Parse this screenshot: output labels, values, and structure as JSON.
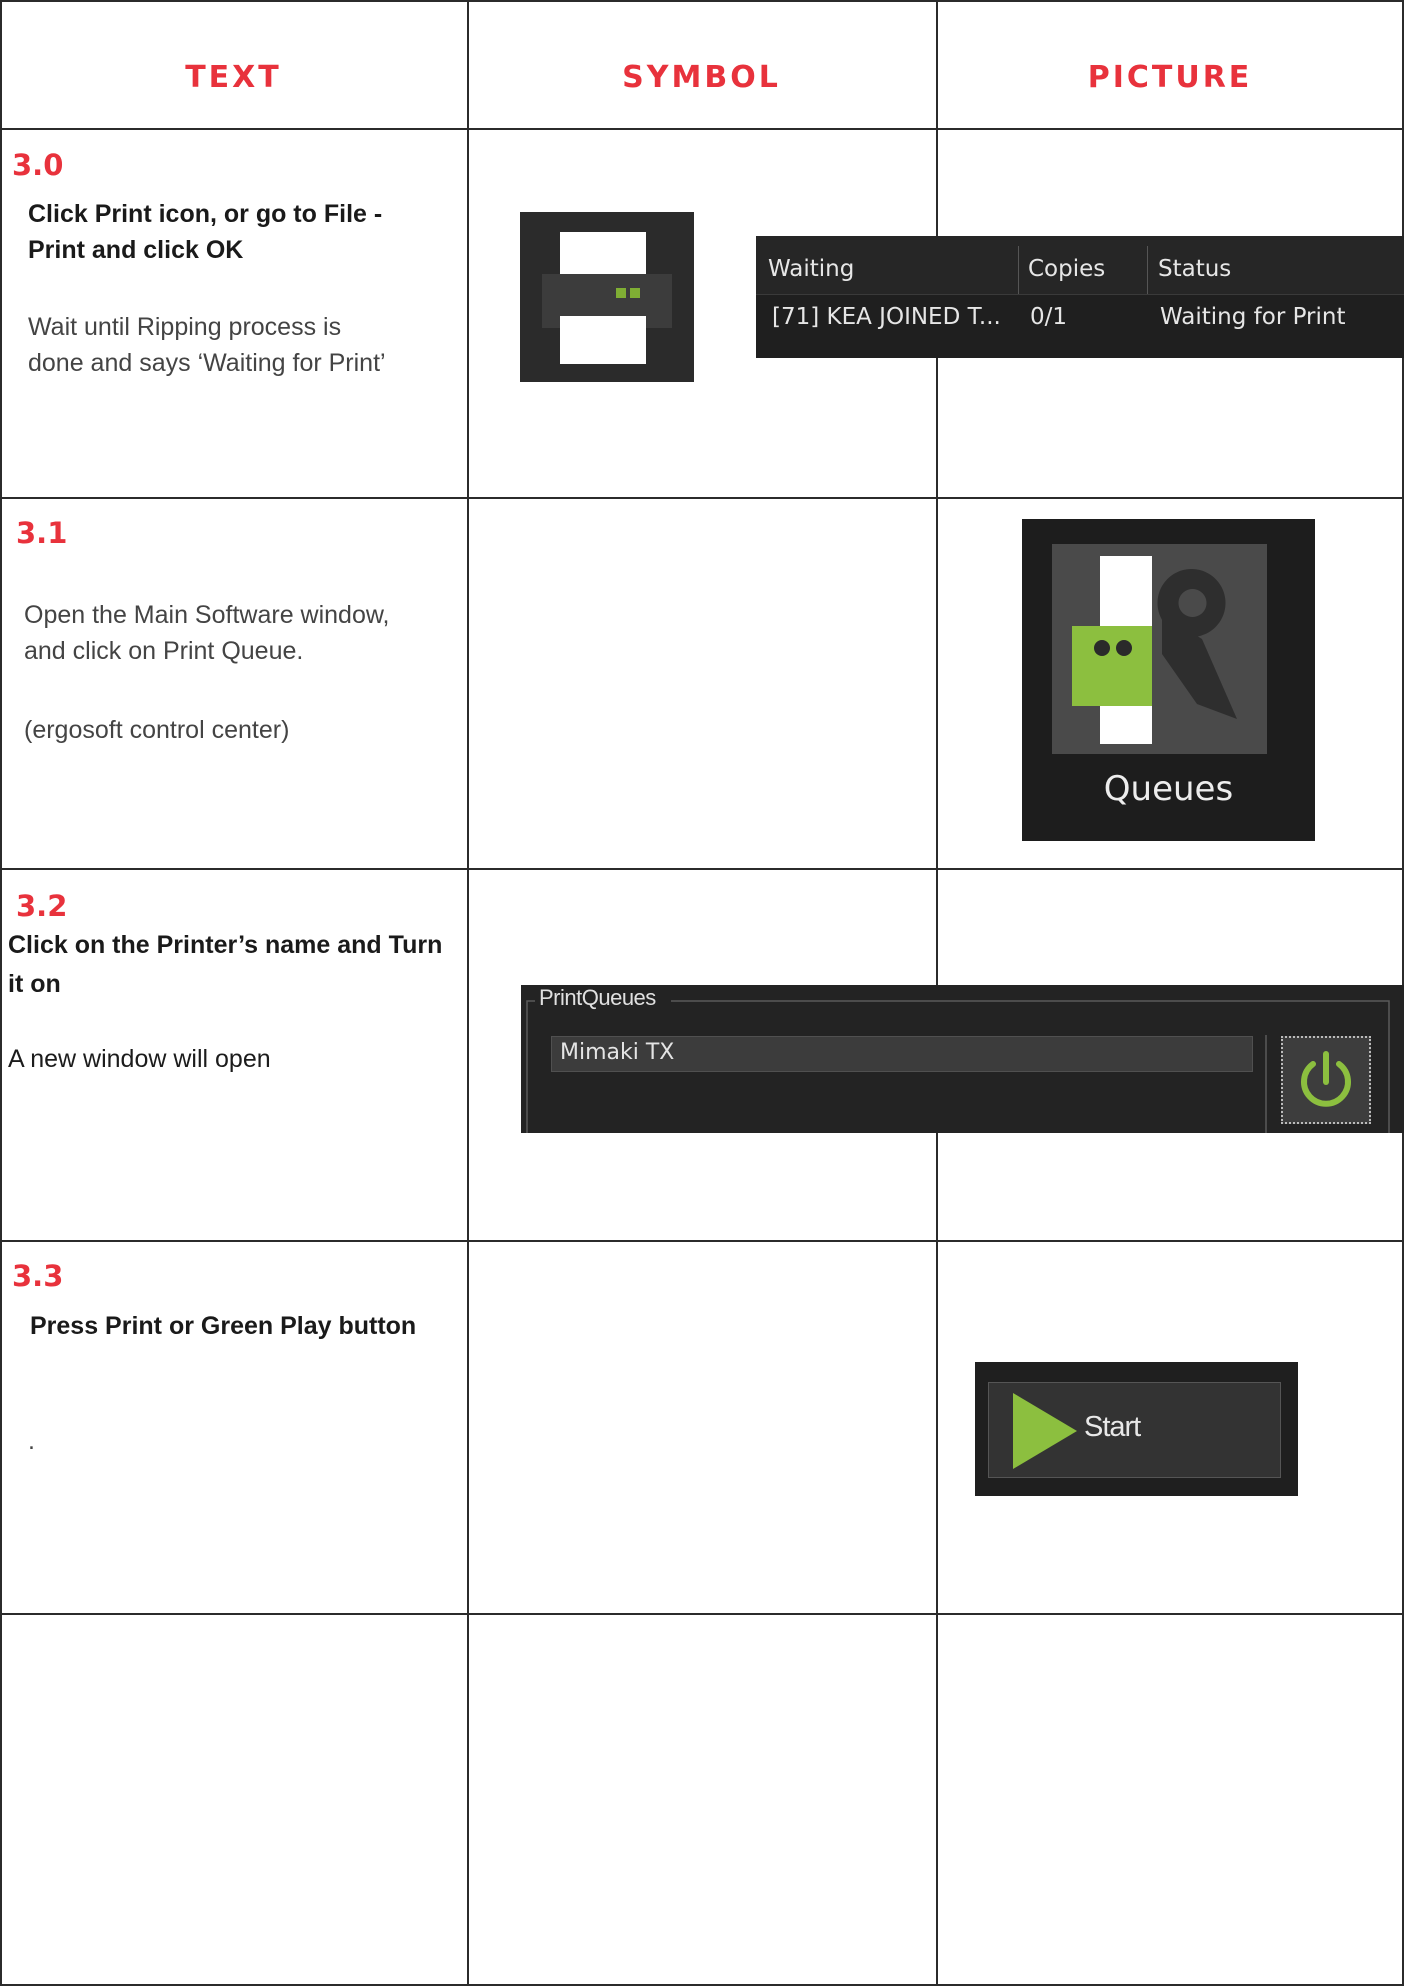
{
  "headers": {
    "text": "TEXT",
    "symbol": "SYMBOL",
    "picture": "PICTURE"
  },
  "steps": [
    {
      "number": "3.0",
      "instruction": [
        "Click Print icon, or go to File -",
        "Print and click OK"
      ],
      "note": [
        "Wait until Ripping process is",
        "done and says ‘Waiting for Print’"
      ],
      "symbol_icon": "printer-icon",
      "queue_table": {
        "columns": [
          "Waiting",
          "Copies",
          "Status"
        ],
        "row": {
          "job": "[71]  KEA JOINED T...",
          "copies": "0/1",
          "status": "Waiting for Print"
        }
      }
    },
    {
      "number": "3.1",
      "note": [
        "Open the Main Software window,",
        "and click on Print Queue."
      ],
      "note2": "(ergosoft control center)",
      "picture": {
        "icon": "queues-icon",
        "label": "Queues"
      }
    },
    {
      "number": "3.2",
      "instruction": [
        "Click on the Printer’s name and Turn",
        "it on"
      ],
      "note": "A new window will open",
      "picture": {
        "panel_title": "PrintQueues",
        "printer": "Mimaki TX",
        "button_icon": "power-icon"
      }
    },
    {
      "number": "3.3",
      "instruction": "Press Print or Green Play button",
      "note": ".",
      "picture": {
        "button_label": "Start",
        "button_icon": "play-icon"
      }
    }
  ],
  "colors": {
    "accent_red": "#e8323c",
    "green": "#8cbf3f",
    "dark_ui": "#232323"
  }
}
